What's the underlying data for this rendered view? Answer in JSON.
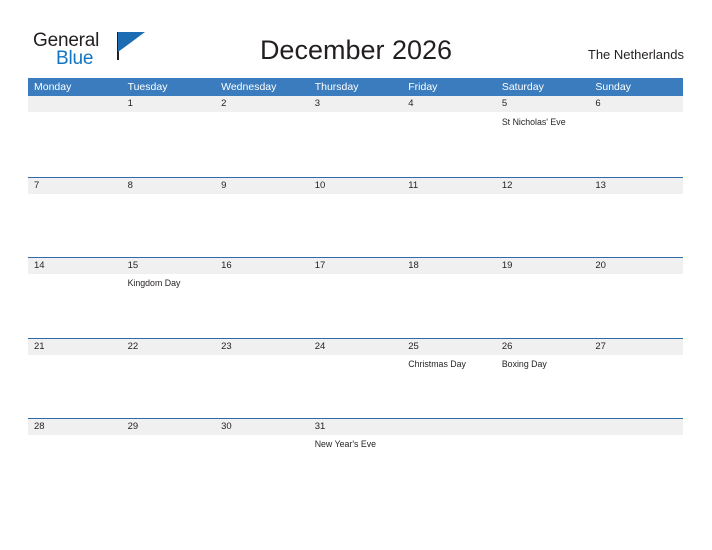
{
  "brand": {
    "name_part1": "General",
    "name_part2": "Blue",
    "flag_icon": "blue-triangle-flag-icon",
    "color_dark": "#231f20",
    "color_blue": "#1275c4"
  },
  "header": {
    "title": "December 2026",
    "country": "The Netherlands"
  },
  "theme": {
    "header_blue": "#3a7cbe",
    "row_line_blue": "#2f6ca5",
    "daynum_band_gray": "#f0f0f0",
    "text_dark": "#231f20",
    "page_background": "#ffffff"
  },
  "calendar": {
    "weekdays": [
      "Monday",
      "Tuesday",
      "Wednesday",
      "Thursday",
      "Friday",
      "Saturday",
      "Sunday"
    ],
    "weeks": [
      {
        "days": [
          {
            "num": "",
            "events": []
          },
          {
            "num": "1",
            "events": []
          },
          {
            "num": "2",
            "events": []
          },
          {
            "num": "3",
            "events": []
          },
          {
            "num": "4",
            "events": []
          },
          {
            "num": "5",
            "events": [
              "St Nicholas' Eve"
            ]
          },
          {
            "num": "6",
            "events": []
          }
        ]
      },
      {
        "days": [
          {
            "num": "7",
            "events": []
          },
          {
            "num": "8",
            "events": []
          },
          {
            "num": "9",
            "events": []
          },
          {
            "num": "10",
            "events": []
          },
          {
            "num": "11",
            "events": []
          },
          {
            "num": "12",
            "events": []
          },
          {
            "num": "13",
            "events": []
          }
        ]
      },
      {
        "days": [
          {
            "num": "14",
            "events": []
          },
          {
            "num": "15",
            "events": [
              "Kingdom Day"
            ]
          },
          {
            "num": "16",
            "events": []
          },
          {
            "num": "17",
            "events": []
          },
          {
            "num": "18",
            "events": []
          },
          {
            "num": "19",
            "events": []
          },
          {
            "num": "20",
            "events": []
          }
        ]
      },
      {
        "days": [
          {
            "num": "21",
            "events": []
          },
          {
            "num": "22",
            "events": []
          },
          {
            "num": "23",
            "events": []
          },
          {
            "num": "24",
            "events": []
          },
          {
            "num": "25",
            "events": [
              "Christmas Day"
            ]
          },
          {
            "num": "26",
            "events": [
              "Boxing Day"
            ]
          },
          {
            "num": "27",
            "events": []
          }
        ]
      },
      {
        "days": [
          {
            "num": "28",
            "events": []
          },
          {
            "num": "29",
            "events": []
          },
          {
            "num": "30",
            "events": []
          },
          {
            "num": "31",
            "events": [
              "New Year's Eve"
            ]
          },
          {
            "num": "",
            "events": []
          },
          {
            "num": "",
            "events": []
          },
          {
            "num": "",
            "events": []
          }
        ]
      }
    ]
  }
}
